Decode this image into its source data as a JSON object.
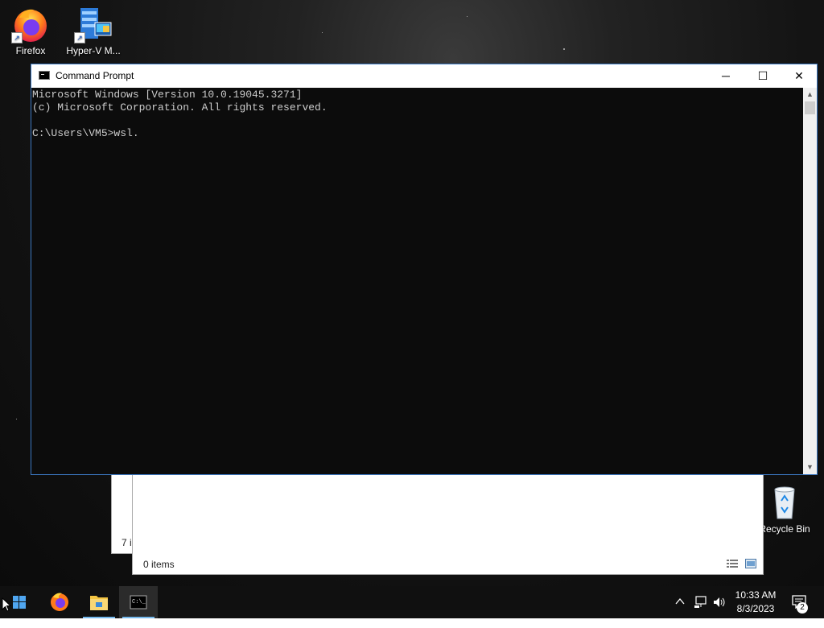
{
  "desktop": {
    "icons": [
      {
        "label": "Firefox",
        "icon": "firefox-icon"
      },
      {
        "label": "Hyper-V M...",
        "icon": "hyper-v-icon"
      },
      {
        "label": "Recycle Bin",
        "icon": "recycle-bin-icon"
      }
    ]
  },
  "cmd_window": {
    "title": "Command Prompt",
    "icon": "cmd-icon",
    "controls": {
      "minimize": "─",
      "maximize": "☐",
      "close": "✕"
    },
    "lines": [
      "Microsoft Windows [Version 10.0.19045.3271]",
      "(c) Microsoft Corporation. All rights reserved.",
      "",
      "C:\\Users\\VM5>wsl."
    ]
  },
  "explorer_window": {
    "status_items": "0 items",
    "peek_text": "7 i"
  },
  "taskbar": {
    "apps": [
      "start-button",
      "firefox",
      "file-explorer",
      "command-prompt"
    ],
    "active_app": "command-prompt",
    "clock_time": "10:33 AM",
    "clock_date": "8/3/2023",
    "notification_count": "2"
  },
  "colors": {
    "console_bg": "#0c0c0c",
    "console_fg": "#cccccc",
    "taskbar_bg": "#101010",
    "accent": "#76b9ed"
  }
}
